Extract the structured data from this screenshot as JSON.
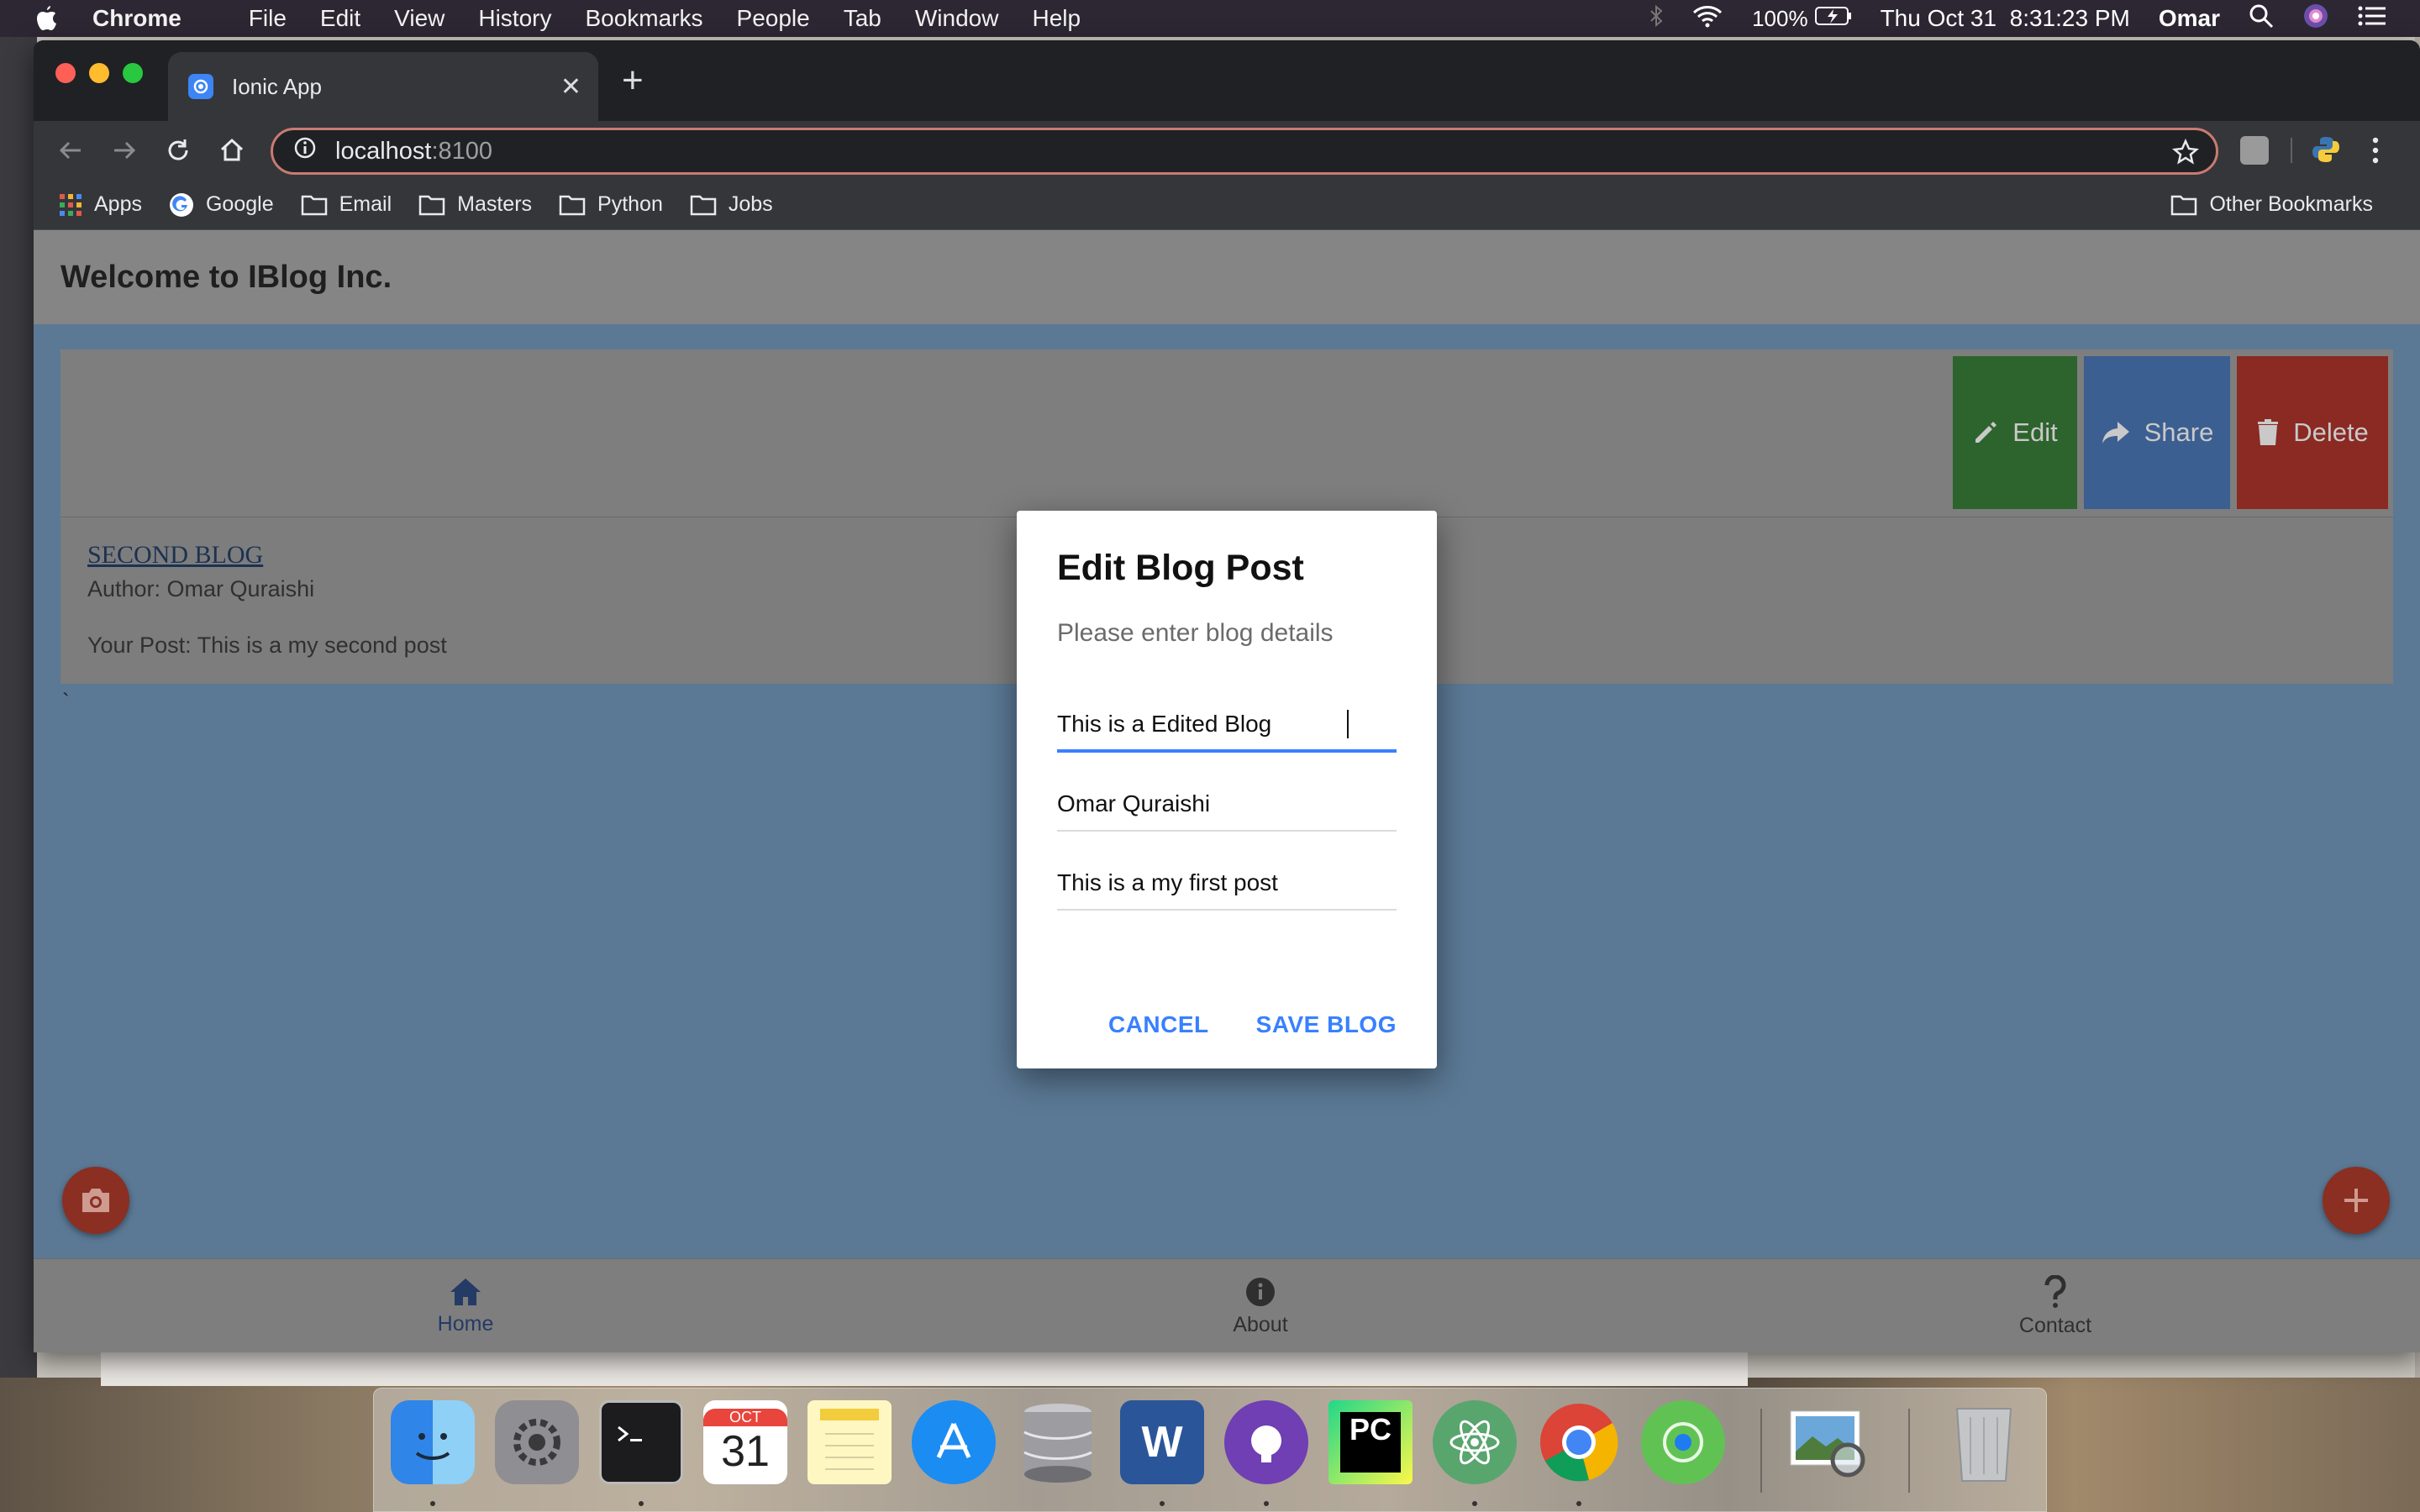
{
  "menubar": {
    "app_name": "Chrome",
    "items": [
      "File",
      "Edit",
      "View",
      "History",
      "Bookmarks",
      "People",
      "Tab",
      "Window",
      "Help"
    ],
    "battery": "100%",
    "clock": "Thu Oct 31  8:31:23 PM",
    "user": "Omar"
  },
  "browser": {
    "tab_title": "Ionic App",
    "url_host": "localhost",
    "url_port": ":8100",
    "bookmarks": [
      "Apps",
      "Google",
      "Email",
      "Masters",
      "Python",
      "Jobs"
    ],
    "other_bookmarks": "Other Bookmarks"
  },
  "app": {
    "header_title": "Welcome to IBlog Inc.",
    "card": {
      "options": {
        "edit": "Edit",
        "share": "Share",
        "delete": "Delete"
      },
      "title": "SECOND BLOG",
      "author": "Author: Omar Quraishi",
      "post": "Your Post: This is a my second post",
      "stray_char": "`"
    },
    "tabs": [
      {
        "label": "Home",
        "active": true
      },
      {
        "label": "About",
        "active": false
      },
      {
        "label": "Contact",
        "active": false
      }
    ],
    "accent_color": "#3880ff"
  },
  "modal": {
    "title": "Edit Blog Post",
    "message": "Please enter blog details",
    "fields": {
      "title": "This is a Edited Blog",
      "author": "Omar Quraishi",
      "post": "This is a my first post"
    },
    "cancel_label": "CANCEL",
    "save_label": "SAVE BLOG"
  },
  "dock": {
    "calendar_month": "OCT",
    "calendar_day": "31",
    "apps": [
      "finder-icon",
      "system-preferences-icon",
      "terminal-icon",
      "calendar-icon",
      "notes-icon",
      "app-store-icon",
      "database-icon",
      "word-icon",
      "github-desktop-icon",
      "pycharm-icon",
      "atom-icon",
      "chrome-icon",
      "find-my-icon",
      "preview-icon",
      "trash-icon"
    ]
  }
}
